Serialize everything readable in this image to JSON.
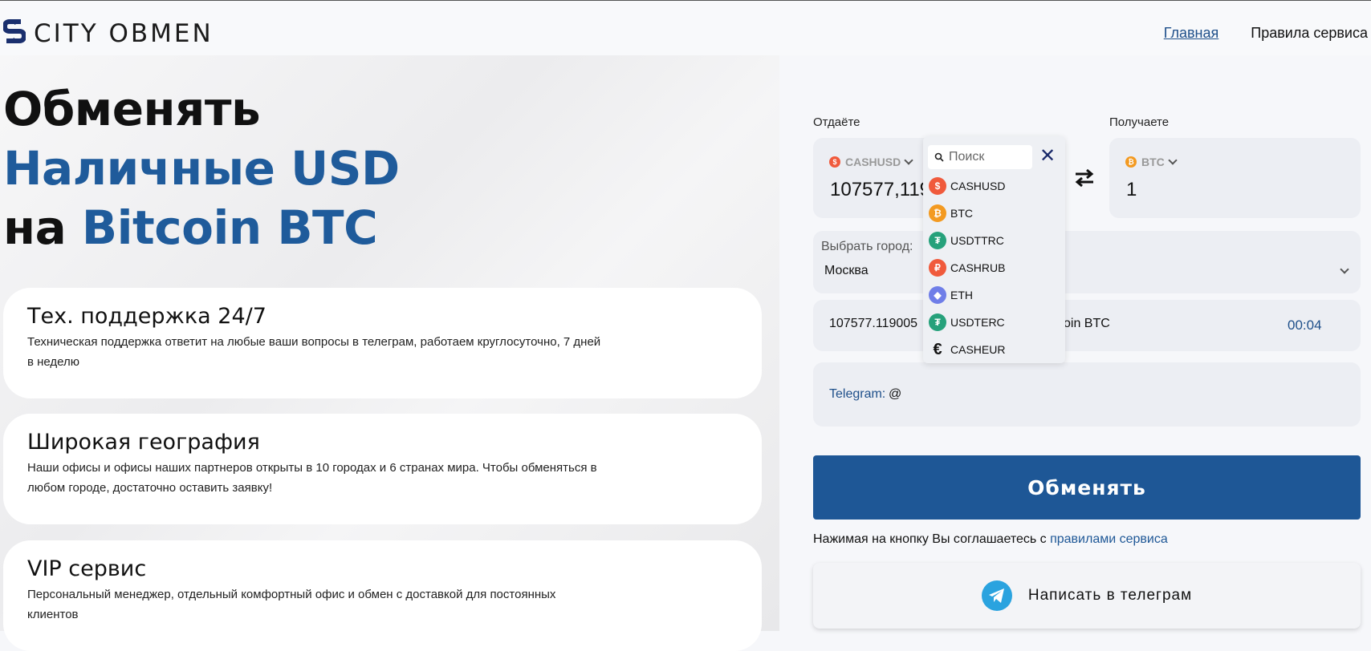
{
  "header": {
    "logo_text": "CITY OBMEN",
    "nav": [
      {
        "label": "Главная"
      },
      {
        "label": "Правила сервиса"
      }
    ]
  },
  "hero": {
    "line1": "Обменять",
    "line2": "Наличные USD",
    "line3_prefix": "на ",
    "line3_accent": "Bitcoin BTC"
  },
  "features": [
    {
      "title": "Тех. поддержка 24/7",
      "text": "Техническая поддержка ответит на любые ваши вопросы в телеграм, работаем круглосуточно, 7 дней в неделю"
    },
    {
      "title": "Широкая география",
      "text": "Наши офисы и офисы наших партнеров открыты в 10 городах и 6 странах мира. Чтобы обменяться в любом городе, достаточно оставить заявку!"
    },
    {
      "title": "VIP сервис",
      "text": "Персональный менеджер, отдельный комфортный офис и обмен с доставкой для постоянных клиентов"
    }
  ],
  "form": {
    "give_label": "Отдаёте",
    "get_label": "Получаете",
    "give_currency": "CASHUSD",
    "give_amount": "107577,119",
    "get_currency": "BTC",
    "get_amount": "1",
    "city_label": "Выбрать город:",
    "city_value": "Москва",
    "summary_left": "107577.119005",
    "summary_right": "coin BTC",
    "timer": "00:04",
    "telegram_label": "Telegram:",
    "telegram_value": "@",
    "exchange_button": "Обменять",
    "agree_text": "Нажимая на кнопку Вы соглашаетесь с ",
    "agree_link": "правилами сервиса",
    "telegram_button": "Написать в телеграм"
  },
  "dropdown": {
    "search_placeholder": "Поиск",
    "options": [
      {
        "label": "CASHUSD",
        "icon": "dollar-icon",
        "color": "#f05a3c",
        "glyph": "$"
      },
      {
        "label": "BTC",
        "icon": "bitcoin-icon",
        "color": "#f39a21",
        "glyph": "₿"
      },
      {
        "label": "USDTTRC",
        "icon": "tether-icon",
        "color": "#26a17b",
        "glyph": "₮"
      },
      {
        "label": "CASHRUB",
        "icon": "ruble-icon",
        "color": "#f05a3c",
        "glyph": "₽"
      },
      {
        "label": "ETH",
        "icon": "ethereum-icon",
        "color": "#6f7ee8",
        "glyph": "◆"
      },
      {
        "label": "USDTERC",
        "icon": "tether-icon",
        "color": "#26a17b",
        "glyph": "₮"
      },
      {
        "label": "CASHEUR",
        "icon": "euro-icon",
        "color": "#111111",
        "glyph": "€"
      }
    ]
  },
  "colors": {
    "brand_blue": "#1e5796",
    "hero_blue": "#1f5b9b",
    "telegram_blue": "#2aa3df"
  }
}
